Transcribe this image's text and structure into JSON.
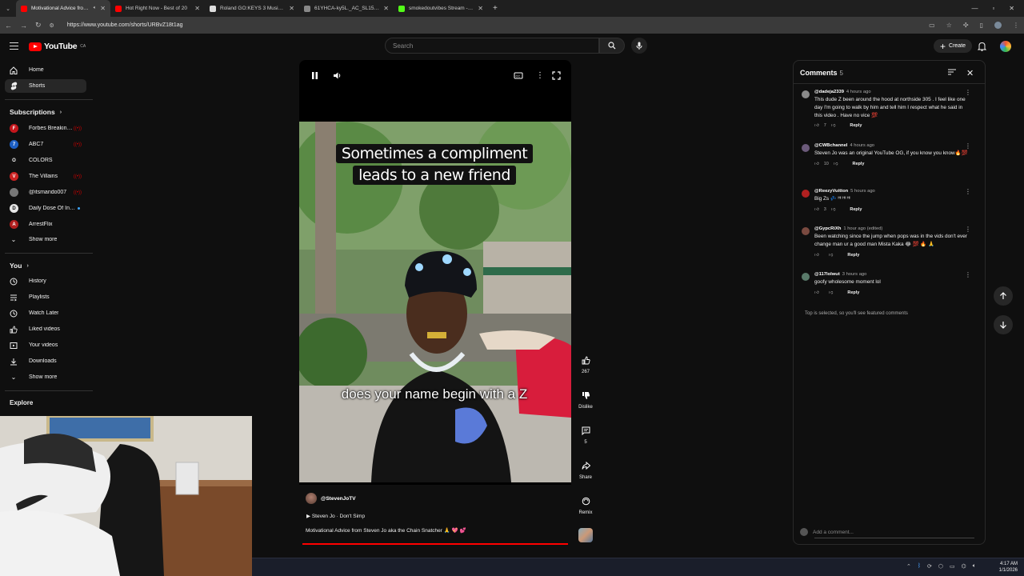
{
  "browser": {
    "tabs": [
      {
        "title": "Motivational Advice from St",
        "color": "#ff0000",
        "active": true
      },
      {
        "title": "Hot Right Now - Best of 20",
        "color": "#ff0000",
        "active": false
      },
      {
        "title": "Roland GO:KEYS 3 Music Creati",
        "color": "#dddddd",
        "active": false
      },
      {
        "title": "61YHCA-ky5L._AC_SL1500_.jpg",
        "color": "#888888",
        "active": false
      },
      {
        "title": "smokedoutvibes Stream - Watc",
        "color": "#53fc18",
        "active": false
      }
    ],
    "url": "https://www.youtube.com/shorts/URBvZ18t1ag"
  },
  "header": {
    "logo_text": "YouTube",
    "region": "CA",
    "search_placeholder": "Search",
    "create_label": "Create"
  },
  "sidebar": {
    "main": [
      {
        "label": "Home",
        "icon": "home-icon"
      },
      {
        "label": "Shorts",
        "icon": "shorts-icon",
        "active": true
      }
    ],
    "subscriptions_title": "Subscriptions",
    "subscriptions": [
      {
        "label": "Forbes Breaking ...",
        "color": "#c4161c",
        "glyph": "F",
        "badge": "live"
      },
      {
        "label": "ABC7",
        "color": "#1d5fc4",
        "glyph": "7",
        "badge": "live"
      },
      {
        "label": "COLORS",
        "color": "#111111",
        "glyph": "O",
        "badge": "none"
      },
      {
        "label": "The Villains",
        "color": "#cc2222",
        "glyph": "V",
        "badge": "live"
      },
      {
        "label": "@itsmando007",
        "color": "#777777",
        "glyph": "",
        "badge": "live"
      },
      {
        "label": "Daily Dose Of Int...",
        "color": "#e5e5e5",
        "glyph": "D",
        "badge": "dot"
      },
      {
        "label": "ArrestFlix",
        "color": "#b01e1e",
        "glyph": "A",
        "badge": "none"
      }
    ],
    "show_more_1": "Show more",
    "you_title": "You",
    "you_items": [
      {
        "label": "History",
        "icon": "history-icon"
      },
      {
        "label": "Playlists",
        "icon": "playlists-icon"
      },
      {
        "label": "Watch Later",
        "icon": "watch-later-icon"
      },
      {
        "label": "Liked videos",
        "icon": "thumbs-up-icon"
      },
      {
        "label": "Your videos",
        "icon": "your-videos-icon"
      },
      {
        "label": "Downloads",
        "icon": "download-icon"
      }
    ],
    "show_more_2": "Show more",
    "explore_title": "Explore"
  },
  "player": {
    "caption_top": "Sometimes a compliment leads to a new friend",
    "caption_bottom": "does your name begin with a Z",
    "channel": "@StevenJoTV",
    "song": "Steven Jo · Don't Simp",
    "description": "Motivational Advice from Steven Jo aka the Chain Snatcher 🙏 💖 💕",
    "progress": 1.0
  },
  "actions": {
    "like_count": "267",
    "dislike_label": "Dislike",
    "comment_count": "5",
    "share_label": "Share",
    "remix_label": "Remix"
  },
  "comments": {
    "title": "Comments",
    "count": "5",
    "items": [
      {
        "author": "@dadeja2339",
        "time": "4 hours ago",
        "text": "This dude Z been around the hood at northside 305 . I feel like one day I'm going to walk by him and tell him I respect what he said in this video . Have no vice 💯",
        "likes": "7",
        "avatar_color": "#8a8a8a"
      },
      {
        "author": "@CWBchannel",
        "time": "4 hours ago",
        "text": "Steven Jo was an original YouTube OG, if you know you know🔥💯",
        "likes": "10",
        "avatar_color": "#6b5a7a"
      },
      {
        "author": "@ReezyVuitton",
        "time": "5 hours ago",
        "text": "Big Zs 💤 ᴴᴵ ᴴᴵ ᴴᴵ",
        "likes": "3",
        "avatar_color": "#b02020"
      },
      {
        "author": "@GypcRiXh",
        "time": "1 hour ago (edited)",
        "text": "Been watching since the jump when pops was in the vids don't ever change man ur a good man Mista Kaka 😂 💯 🔥 🙏",
        "likes": "",
        "avatar_color": "#7a4a40"
      },
      {
        "author": "@117lolwut",
        "time": "3 hours ago",
        "text": "goofy wholesome moment lol",
        "likes": "",
        "avatar_color": "#5a7a6a"
      }
    ],
    "reply_label": "Reply",
    "featured_note": "Top is selected, so you'll see featured comments",
    "add_placeholder": "Add a comment..."
  },
  "taskbar": {
    "time": "4:17 AM",
    "date": "1/1/2026"
  }
}
